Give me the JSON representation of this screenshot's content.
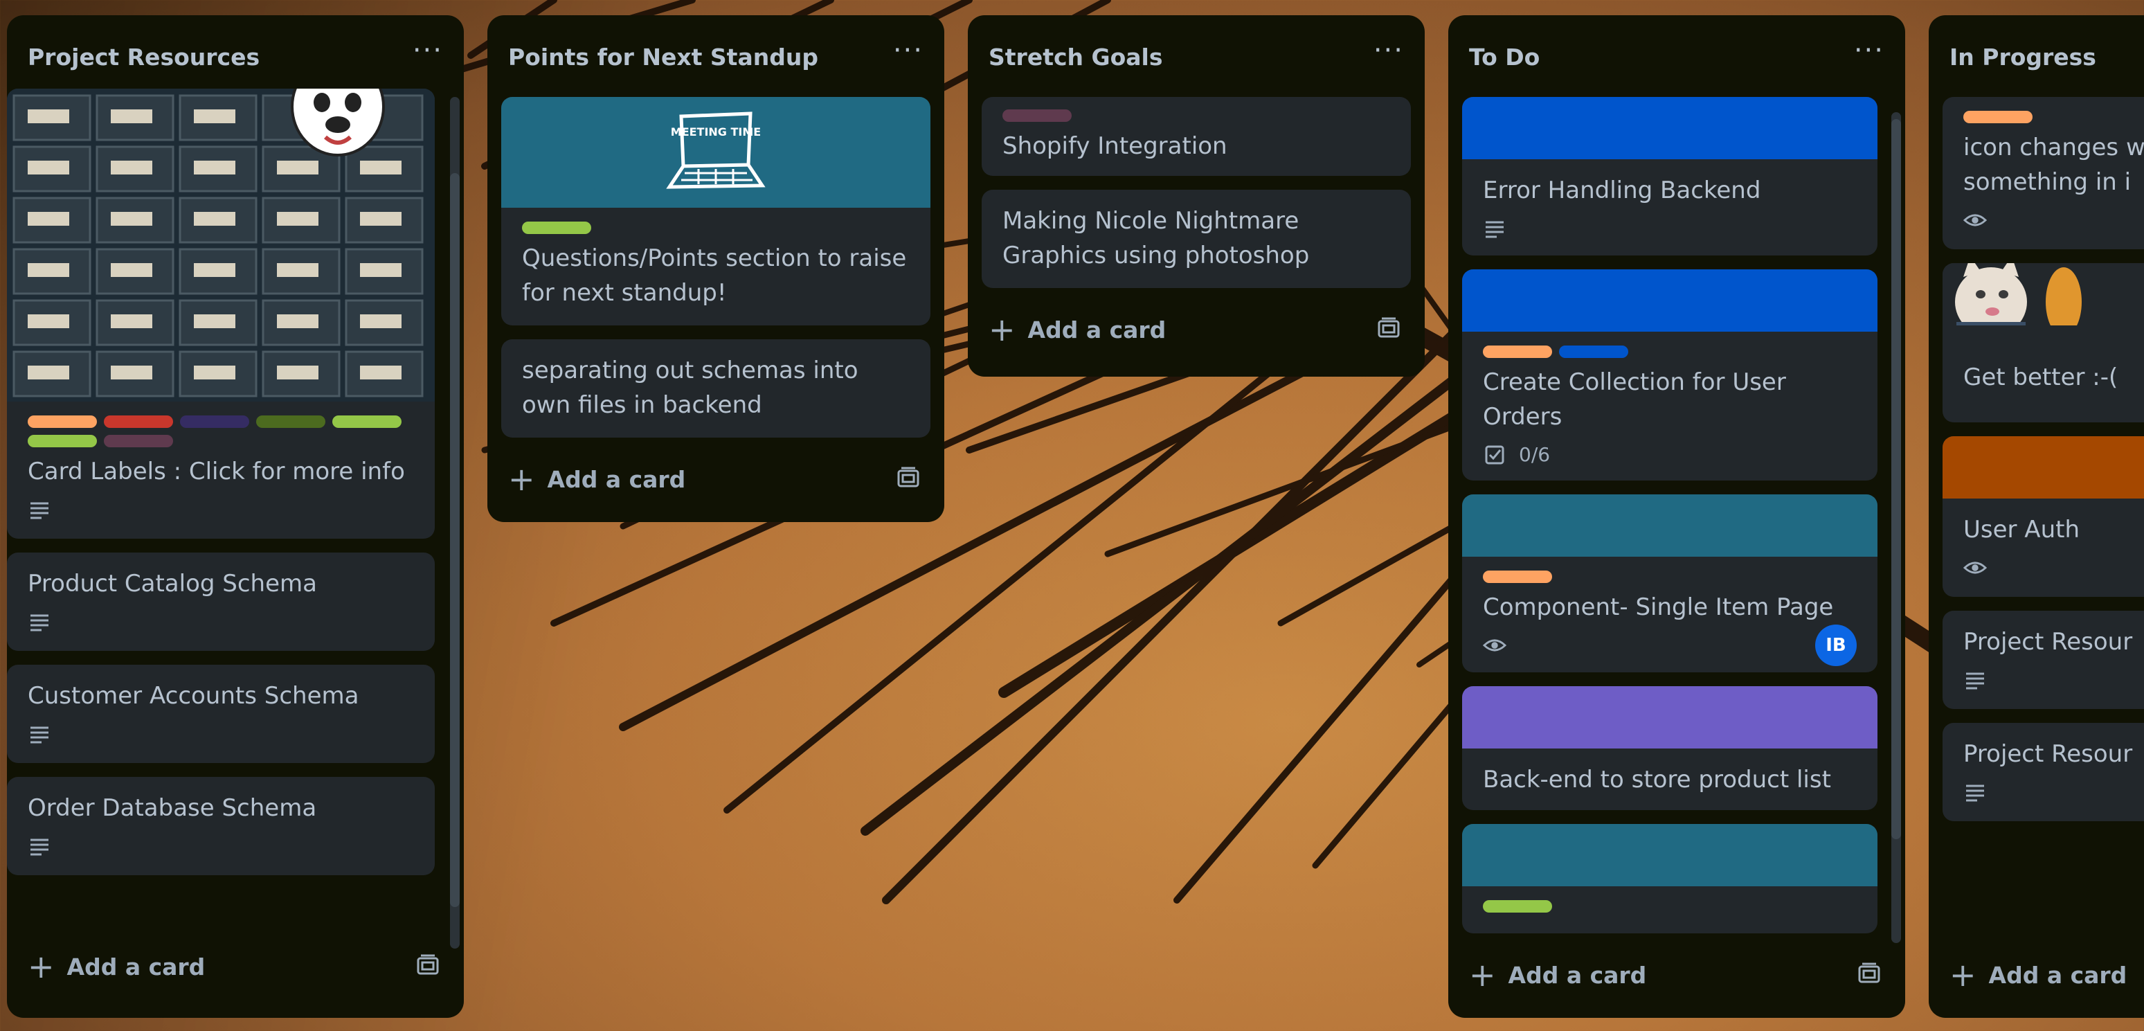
{
  "colors": {
    "list_bg": "#101204",
    "card_bg": "#22272b",
    "text": "#b6c2cf",
    "orange": "#fea362",
    "red": "#c9372c",
    "purple": "#352c63",
    "dark_green": "#4c6b1f",
    "lime": "#94c748",
    "dark_magenta": "#5f3a4e",
    "blue": "#0055cc",
    "teal": "#206a83",
    "violet": "#6e5dc6",
    "rust": "#a54800"
  },
  "lists": [
    {
      "title": "Project Resources",
      "cards": [
        {
          "title": "Card Labels : Click for more info",
          "cover": "image-storage-drawers",
          "labels": [
            "orange",
            "red",
            "purple",
            "dark_green",
            "lime",
            "lime",
            "dark_magenta"
          ],
          "badges": [
            "description-icon"
          ]
        },
        {
          "title": "Product Catalog Schema",
          "badges": [
            "description-icon"
          ]
        },
        {
          "title": "Customer Accounts Schema",
          "badges": [
            "description-icon"
          ]
        },
        {
          "title": "Order Database Schema",
          "badges": [
            "description-icon"
          ]
        }
      ],
      "add_card": "Add a card"
    },
    {
      "title": "Points for Next Standup",
      "cards": [
        {
          "title": "Questions/Points section to raise for next standup!",
          "cover": "meeting-time-laptop-drawing",
          "cover_text": "MEETING TIME",
          "labels": [
            "lime"
          ]
        },
        {
          "title": "separating out schemas into own files in backend"
        }
      ],
      "add_card": "Add a card"
    },
    {
      "title": "Stretch Goals",
      "cards": [
        {
          "title": "Shopify Integration",
          "labels": [
            "dark_magenta"
          ]
        },
        {
          "title": "Making Nicole Nightmare Graphics using photoshop"
        }
      ],
      "add_card": "Add a card"
    },
    {
      "title": "To Do",
      "cards": [
        {
          "title": "Error Handling Backend",
          "cover_color": "blue",
          "badges": [
            "description-icon"
          ]
        },
        {
          "title": "Create Collection for User Orders",
          "cover_color": "blue",
          "labels": [
            "orange",
            "blue"
          ],
          "checklist": "0/6"
        },
        {
          "title": "Component- Single Item Page",
          "cover_color": "teal",
          "labels": [
            "orange"
          ],
          "badges": [
            "watch-icon"
          ],
          "member": "IB"
        },
        {
          "title": "Back-end to store product list",
          "cover_color": "violet"
        },
        {
          "title": "",
          "cover_color": "teal",
          "labels": [
            "lime"
          ]
        }
      ],
      "add_card": "Add a card"
    },
    {
      "title": "In Progress",
      "cards": [
        {
          "title": "icon changes w\nsomething in i",
          "labels": [
            "orange"
          ],
          "badges": [
            "watch-icon"
          ]
        },
        {
          "title": "Get better :-(",
          "cover": "cat-stickers"
        },
        {
          "title": "User Auth",
          "cover_color": "rust",
          "badges": [
            "watch-icon"
          ]
        },
        {
          "title": "Project Resour",
          "badges": [
            "description-icon"
          ]
        },
        {
          "title": "Project Resour",
          "badges": [
            "description-icon"
          ]
        }
      ],
      "add_card": "Add a card"
    }
  ]
}
